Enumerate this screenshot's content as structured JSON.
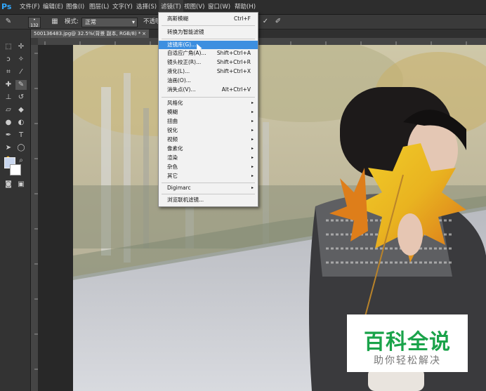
{
  "app": {
    "logo": "Ps"
  },
  "menubar": {
    "items": [
      "文件(F)",
      "编辑(E)",
      "图像(I)",
      "图层(L)",
      "文字(Y)",
      "选择(S)",
      "滤镜(T)",
      "视图(V)",
      "窗口(W)",
      "帮助(H)"
    ]
  },
  "options_bar": {
    "brush_size": "132",
    "mode_label": "模式:",
    "mode_value": "正常",
    "opacity_label": "不透明"
  },
  "document": {
    "tab_title": "500136483.jpg@ 32.5%(背景 副本, RGB/8) *",
    "close": "×"
  },
  "filter_menu": {
    "items": [
      {
        "label": "高斯模糊",
        "shortcut": "Ctrl+F"
      },
      {
        "label": "转换为智能滤镜"
      },
      {
        "label": "滤镜库(G)...",
        "highlighted": true
      },
      {
        "label": "自适应广角(A)...",
        "shortcut": "Shift+Ctrl+A"
      },
      {
        "label": "镜头校正(R)...",
        "shortcut": "Shift+Ctrl+R"
      },
      {
        "label": "液化(L)...",
        "shortcut": "Shift+Ctrl+X"
      },
      {
        "label": "油画(O)..."
      },
      {
        "label": "消失点(V)...",
        "shortcut": "Alt+Ctrl+V"
      },
      {
        "label": "风格化",
        "submenu": true
      },
      {
        "label": "模糊",
        "submenu": true
      },
      {
        "label": "扭曲",
        "submenu": true
      },
      {
        "label": "锐化",
        "submenu": true
      },
      {
        "label": "视频",
        "submenu": true
      },
      {
        "label": "像素化",
        "submenu": true
      },
      {
        "label": "渲染",
        "submenu": true
      },
      {
        "label": "杂色",
        "submenu": true
      },
      {
        "label": "其它",
        "submenu": true
      },
      {
        "label": "Digimarc",
        "submenu": true
      },
      {
        "label": "浏览联机滤镜..."
      }
    ],
    "arrow": "▸"
  },
  "watermark": {
    "title": "百科全说",
    "subtitle": "助你轻松解决"
  },
  "colors": {
    "highlight": "#3d8fe0",
    "watermark_green": "#1aa34a",
    "ps_blue": "#31a8ff"
  }
}
